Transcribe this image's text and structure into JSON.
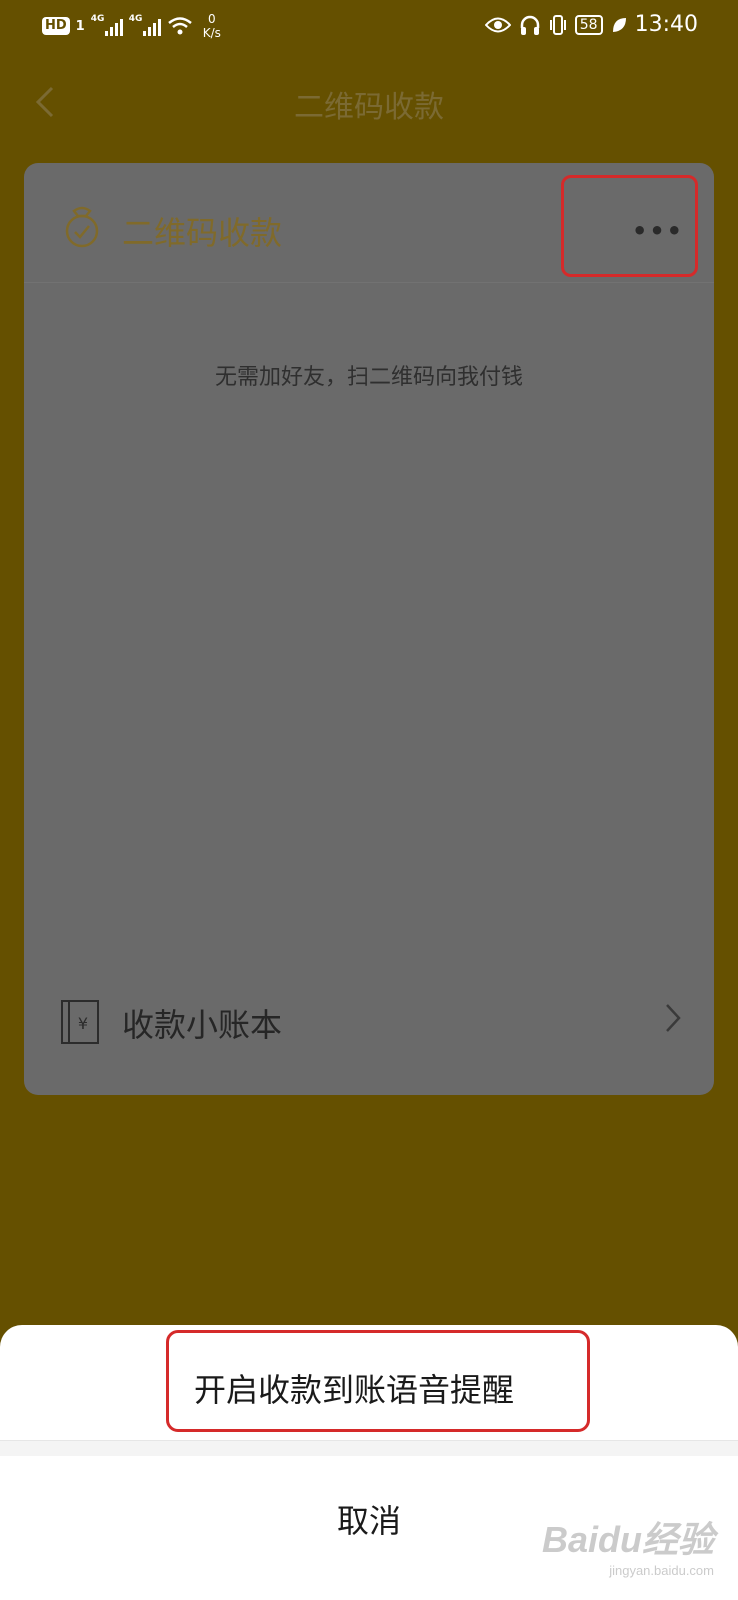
{
  "status_bar": {
    "hd": "HD",
    "sim": "1",
    "net1": "4G",
    "net2": "4G",
    "speed_value": "0",
    "speed_unit": "K/s",
    "battery": "58",
    "time": "13:40"
  },
  "nav": {
    "title": "二维码收款",
    "back_icon": "chevron-left-icon"
  },
  "card": {
    "title": "二维码收款",
    "more_label": "•••",
    "subtitle": "无需加好友，扫二维码向我付钱",
    "ledger_label": "收款小账本",
    "ledger_icon": "ledger-yuan-icon"
  },
  "sheet": {
    "option_label": "开启收款到账语音提醒",
    "cancel_label": "取消"
  },
  "watermark": {
    "brand": "Baidu经验",
    "url": "jingyan.baidu.com"
  },
  "colors": {
    "overlay_bg": "#655000",
    "card_bg": "#6a6a6a",
    "highlight": "#d52a2a",
    "sheet_bg": "#ffffff"
  }
}
